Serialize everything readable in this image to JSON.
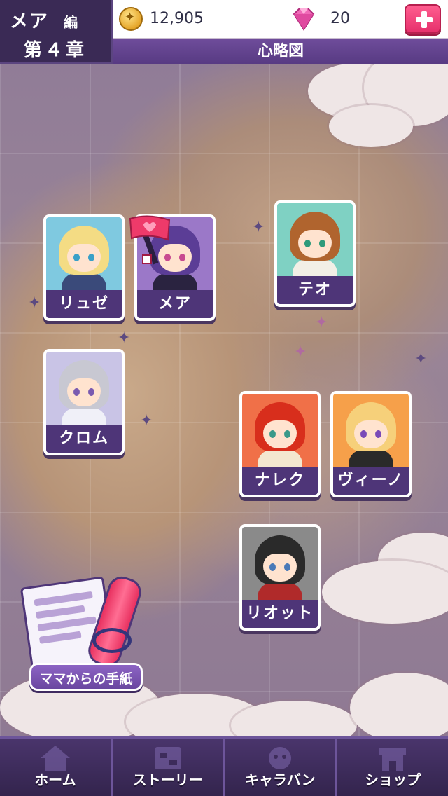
{
  "header": {
    "chapter_name": "メア",
    "chapter_suffix": "編",
    "chapter_number": "第４章",
    "coins": "12,905",
    "gems": "20",
    "screen_title": "心略図"
  },
  "characters": [
    {
      "id": "ryuze",
      "name": "リュゼ",
      "bg": "#7fc9e0",
      "hair": "#f4dc84",
      "eye": "#3aa0c8",
      "body": "#3a4a7a"
    },
    {
      "id": "mea",
      "name": "メア",
      "bg": "#9b78c8",
      "hair": "#5b3d96",
      "eye": "#c84a90",
      "body": "#2a2340"
    },
    {
      "id": "teo",
      "name": "テオ",
      "bg": "#7fd1c3",
      "hair": "#b0642e",
      "eye": "#2f9a7a",
      "body": "#f2efe6"
    },
    {
      "id": "kuromu",
      "name": "クロム",
      "bg": "#c9c4e6",
      "hair": "#c8c8d2",
      "eye": "#7a5ab0",
      "body": "#f0f0f8"
    },
    {
      "id": "nareku",
      "name": "ナレク",
      "bg": "#f07048",
      "hair": "#d82e1c",
      "eye": "#3a9a8a",
      "body": "#f3e7cf"
    },
    {
      "id": "vino",
      "name": "ヴィーノ",
      "bg": "#f6a04a",
      "hair": "#f6d07a",
      "eye": "#7a4ab8",
      "body": "#2a2a2a"
    },
    {
      "id": "riotto",
      "name": "リオット",
      "bg": "#8a8a8a",
      "hair": "#2a2a2a",
      "eye": "#4a7ab8",
      "body": "#b02a2a"
    }
  ],
  "letter_button": {
    "label": "ママからの手紙"
  },
  "bottom_nav": [
    {
      "label": "ホーム",
      "icon": "home-icon"
    },
    {
      "label": "ストーリー",
      "icon": "story-icon"
    },
    {
      "label": "キャラバン",
      "icon": "caravan-icon"
    },
    {
      "label": "ショップ",
      "icon": "shop-icon"
    }
  ],
  "colors": {
    "accent_purple": "#4e3578",
    "pink": "#e6306c",
    "gold": "#e6a62a"
  }
}
